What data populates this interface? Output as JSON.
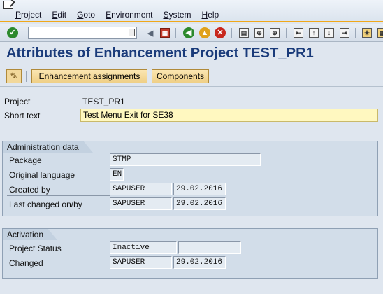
{
  "menu": {
    "items": [
      "Project",
      "Edit",
      "Goto",
      "Environment",
      "System",
      "Help"
    ]
  },
  "toolbar": {
    "command_value": "",
    "icons": [
      "ok-icon",
      "back-icon",
      "save-icon",
      "back-nav-icon",
      "exit-icon",
      "cancel-icon",
      "print-icon",
      "find-icon",
      "find-next-icon",
      "first-page-icon",
      "prev-page-icon",
      "next-page-icon",
      "last-page-icon",
      "new-session-icon",
      "shortcut-icon"
    ]
  },
  "page": {
    "title": "Attributes of Enhancement Project TEST_PR1"
  },
  "apptoolbar": {
    "enh_label": "Enhancement assignments",
    "comp_label": "Components"
  },
  "project": {
    "project_label": "Project",
    "project_value": "TEST_PR1",
    "short_label": "Short text",
    "short_value": "Test Menu Exit for SE38"
  },
  "admin": {
    "title": "Administration data",
    "package_label": "Package",
    "package_value": "$TMP",
    "lang_label": "Original language",
    "lang_value": "EN",
    "created_label": "Created by",
    "created_user": "SAPUSER",
    "created_date": "29.02.2016",
    "changed_label": "Last changed on/by",
    "changed_user": "SAPUSER",
    "changed_date": "29.02.2016"
  },
  "activation": {
    "title": "Activation",
    "status_label": "Project Status",
    "status_value": "Inactive",
    "status_extra": "",
    "changed_label": "Changed",
    "changed_user": "SAPUSER",
    "changed_date": "29.02.2016"
  },
  "colors": {
    "title": "#1a3b7a",
    "accent": "#f0a81a",
    "button": "#efcf86",
    "required_field": "#fff8c0"
  }
}
